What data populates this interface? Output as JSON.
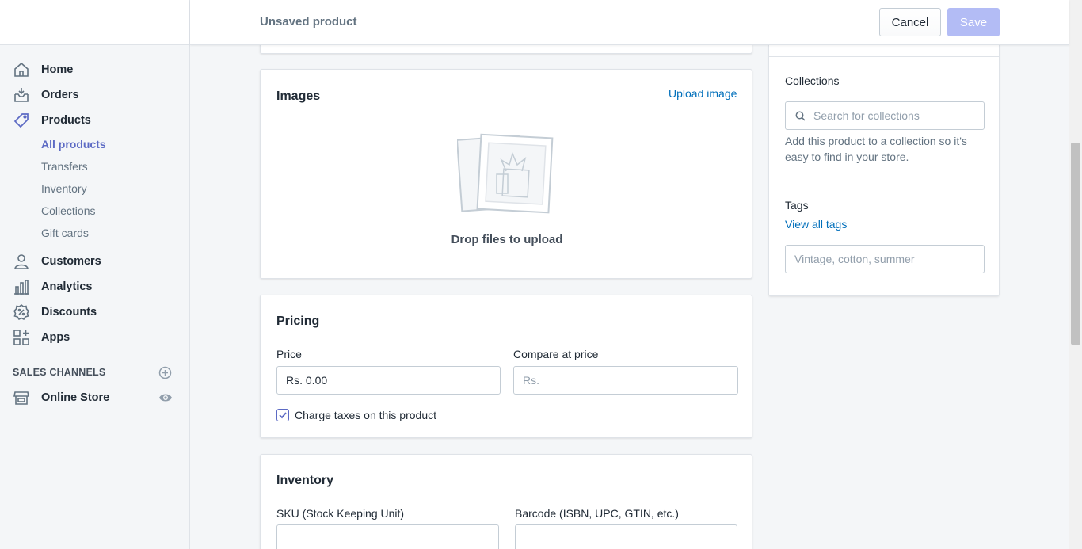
{
  "topbar": {
    "title": "Unsaved product",
    "cancel_label": "Cancel",
    "save_label": "Save"
  },
  "nav": {
    "items": [
      {
        "label": "Home",
        "icon": "home-icon"
      },
      {
        "label": "Orders",
        "icon": "orders-icon"
      },
      {
        "label": "Products",
        "icon": "tag-icon",
        "active": true
      },
      {
        "label": "Customers",
        "icon": "person-icon"
      },
      {
        "label": "Analytics",
        "icon": "bar-chart-icon"
      },
      {
        "label": "Discounts",
        "icon": "discount-icon"
      },
      {
        "label": "Apps",
        "icon": "apps-icon"
      }
    ],
    "products_subitems": [
      "All products",
      "Transfers",
      "Inventory",
      "Collections",
      "Gift cards"
    ],
    "sales_channels_header": "SALES CHANNELS",
    "online_store_label": "Online Store"
  },
  "images_card": {
    "title": "Images",
    "upload_link": "Upload image",
    "drop_text": "Drop files to upload"
  },
  "pricing_card": {
    "title": "Pricing",
    "price_label": "Price",
    "price_value": "Rs. 0.00",
    "compare_label": "Compare at price",
    "compare_placeholder": "Rs.",
    "charge_taxes_label": "Charge taxes on this product",
    "charge_taxes_checked": true
  },
  "inventory_card": {
    "title": "Inventory",
    "sku_label": "SKU (Stock Keeping Unit)",
    "barcode_label": "Barcode (ISBN, UPC, GTIN, etc.)"
  },
  "organization_card": {
    "collections_label": "Collections",
    "collections_placeholder": "Search for collections",
    "collections_help": "Add this product to a collection so it's easy to find in your store.",
    "tags_label": "Tags",
    "view_all_tags": "View all tags",
    "tags_placeholder": "Vintage, cotton, summer"
  },
  "colors": {
    "accent": "#5c6ac4",
    "link": "#006fbb",
    "save_disabled": "#b3bcf5"
  }
}
